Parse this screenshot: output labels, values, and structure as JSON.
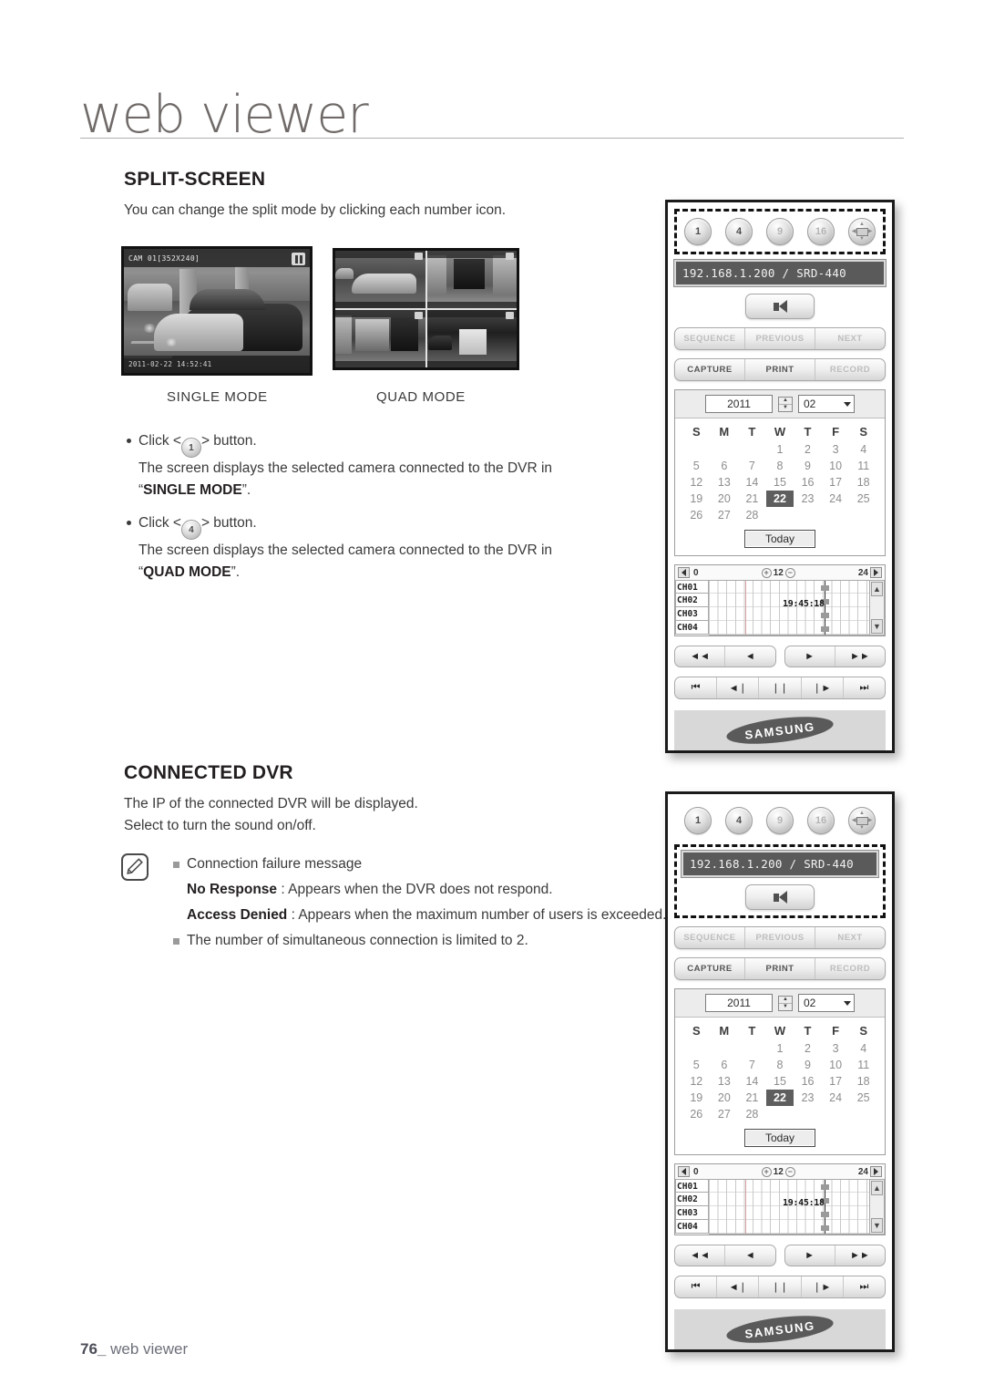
{
  "header": {
    "title": "web viewer"
  },
  "footer": {
    "page": "76_",
    "label": "web viewer"
  },
  "sections": {
    "split_screen": {
      "title": "SPLIT-SCREEN",
      "intro": "You can change the split mode by clicking each number icon.",
      "single_mode_label": "SINGLE MODE",
      "quad_mode_label": "QUAD MODE",
      "bullets": [
        {
          "click_prefix": "Click <",
          "button": "1",
          "click_suffix": "> button.",
          "line2": "The screen displays the selected camera connected to the DVR in",
          "line3_quoted": "SINGLE MODE",
          "line3_pre": "“",
          "line3_post": "”."
        },
        {
          "click_prefix": "Click <",
          "button": "4",
          "click_suffix": "> button.",
          "line2": "The screen displays the selected camera connected to the DVR in",
          "line3_quoted": "QUAD MODE",
          "line3_pre": "“",
          "line3_post": "”."
        }
      ]
    },
    "connected_dvr": {
      "title": "CONNECTED DVR",
      "line1": "The IP of the connected DVR will be displayed.",
      "line2": "Select to turn the sound on/off.",
      "note": {
        "item1": "Connection failure message",
        "no_response_label": "No Response",
        "no_response_text": " : Appears when the DVR does not respond.",
        "access_denied_label": "Access Denied",
        "access_denied_text": " : Appears when the maximum number of users is exceeded.",
        "item2": "The number of simultaneous connection is limited to 2."
      }
    }
  },
  "camera_single": {
    "osd_title": "CAM 01[352X240]",
    "timestamp": "2011-02-22 14:52:41"
  },
  "dvr_panel": {
    "split_buttons": [
      {
        "label": "1",
        "state": "active"
      },
      {
        "label": "4",
        "state": "active"
      },
      {
        "label": "9",
        "state": "disabled"
      },
      {
        "label": "16",
        "state": "disabled"
      },
      {
        "label": "dpad",
        "state": "active"
      }
    ],
    "ip_display": "192.168.1.200   / SRD-440",
    "sound_button_icon": "speaker-icon",
    "nav_buttons": [
      {
        "label": "SEQUENCE",
        "state": "disabled"
      },
      {
        "label": "PREVIOUS",
        "state": "disabled"
      },
      {
        "label": "NEXT",
        "state": "disabled"
      }
    ],
    "action_buttons": [
      {
        "label": "CAPTURE",
        "state": "active"
      },
      {
        "label": "PRINT",
        "state": "active"
      },
      {
        "label": "RECORD",
        "state": "disabled"
      }
    ],
    "calendar": {
      "year": "2011",
      "month": "02",
      "weekdays": [
        "S",
        "M",
        "T",
        "W",
        "T",
        "F",
        "S"
      ],
      "weeks": [
        [
          "",
          "",
          "",
          "1",
          "2",
          "3",
          "4"
        ],
        [
          "5",
          "6",
          "7",
          "8",
          "9",
          "10",
          "11"
        ],
        [
          "12",
          "13",
          "14",
          "15",
          "16",
          "17",
          "18"
        ],
        [
          "19",
          "20",
          "21",
          "22",
          "23",
          "24",
          "25"
        ],
        [
          "26",
          "27",
          "28",
          "",
          "",
          "",
          ""
        ]
      ],
      "selected_day": "22",
      "today_button": "Today"
    },
    "timeline": {
      "scale_start": "0",
      "scale_mid": "12",
      "scale_end": "24",
      "zoom_in_icon": "zoom-in-icon",
      "zoom_out_icon": "zoom-out-icon",
      "channels": [
        "CH01",
        "CH02",
        "CH03",
        "CH04"
      ],
      "current_time": "19:45:18"
    },
    "playback_row1": [
      "◄◄",
      "◄",
      "►",
      "►►"
    ],
    "playback_row2": [
      "⏮",
      "◄❘",
      "❘❘",
      "❘►",
      "⏭"
    ],
    "brand": "SAMSUNG"
  }
}
